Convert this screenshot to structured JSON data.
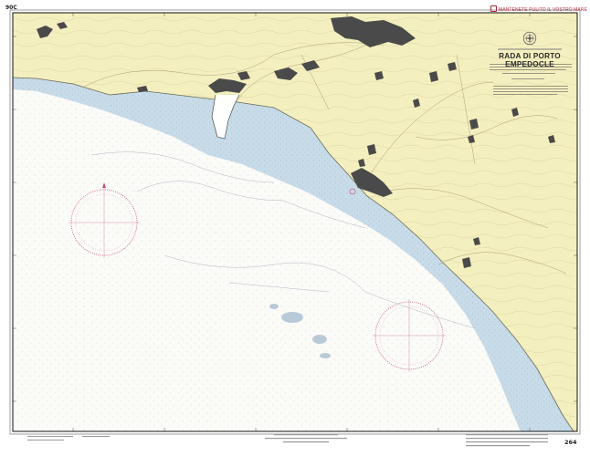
{
  "map": {
    "top_left_number": "90C",
    "banner": "MANTENETE PULITO IL VOSTRO MARE",
    "title": "RADA DI PORTO EMPEDOCLE",
    "sheet_number": "264"
  },
  "colors": {
    "land": "#f4efbf",
    "shallow_water": "#c7dbe8",
    "deep_water": "#fbfbf8",
    "urban": "#4a4a4a",
    "compass_rose": "#cc4b7d",
    "frame": "#111111",
    "banner_text": "#b0263a"
  }
}
